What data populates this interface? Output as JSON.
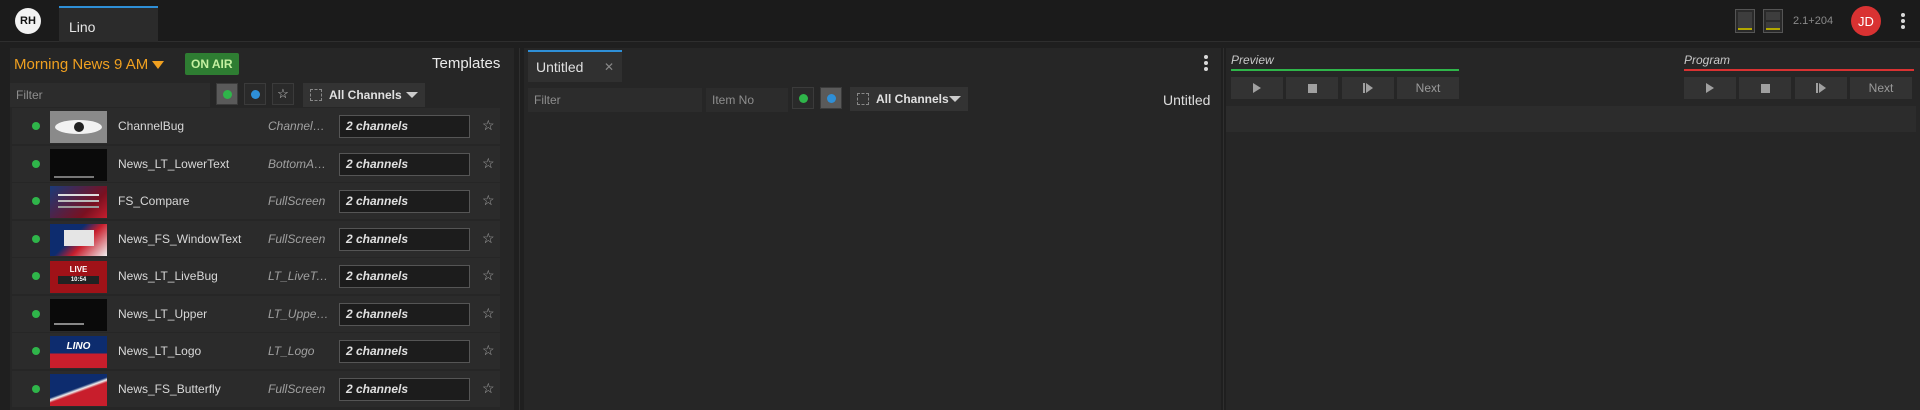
{
  "app": {
    "logo_text": "RH",
    "tab_label": "Lino",
    "version": "2.1+204",
    "user_initials": "JD"
  },
  "templates_panel": {
    "show_name": "Morning News 9 AM",
    "on_air": "ON AIR",
    "title": "Templates",
    "filter_placeholder": "Filter",
    "channels_label": "All Channels",
    "items": [
      {
        "name": "ChannelBug",
        "category": "ChannelBug",
        "channels": "2 channels",
        "thumb": "bug"
      },
      {
        "name": "News_LT_LowerText",
        "category": "BottomArea",
        "channels": "2 channels",
        "thumb": "black-lower"
      },
      {
        "name": "FS_Compare",
        "category": "FullScreen",
        "channels": "2 channels",
        "thumb": "compare"
      },
      {
        "name": "News_FS_WindowText",
        "category": "FullScreen",
        "channels": "2 channels",
        "thumb": "window"
      },
      {
        "name": "News_LT_LiveBug",
        "category": "LT_LiveText",
        "channels": "2 channels",
        "thumb": "live",
        "thumb_text": "LIVE",
        "thumb_time": "10:54"
      },
      {
        "name": "News_LT_Upper",
        "category": "LT_UpperText",
        "channels": "2 channels",
        "thumb": "black-upper"
      },
      {
        "name": "News_LT_Logo",
        "category": "LT_Logo",
        "channels": "2 channels",
        "thumb": "logo",
        "thumb_text": "LINO"
      },
      {
        "name": "News_FS_Butterfly",
        "category": "FullScreen",
        "channels": "2 channels",
        "thumb": "butterfly"
      }
    ]
  },
  "playlist_panel": {
    "tab_label": "Untitled",
    "filter_placeholder": "Filter",
    "item_no_placeholder": "Item No",
    "channels_label": "All Channels",
    "title": "Untitled"
  },
  "output_panel": {
    "preview_label": "Preview",
    "program_label": "Program",
    "next_label": "Next",
    "preview_color": "#2fb54a",
    "program_color": "#d93232"
  }
}
